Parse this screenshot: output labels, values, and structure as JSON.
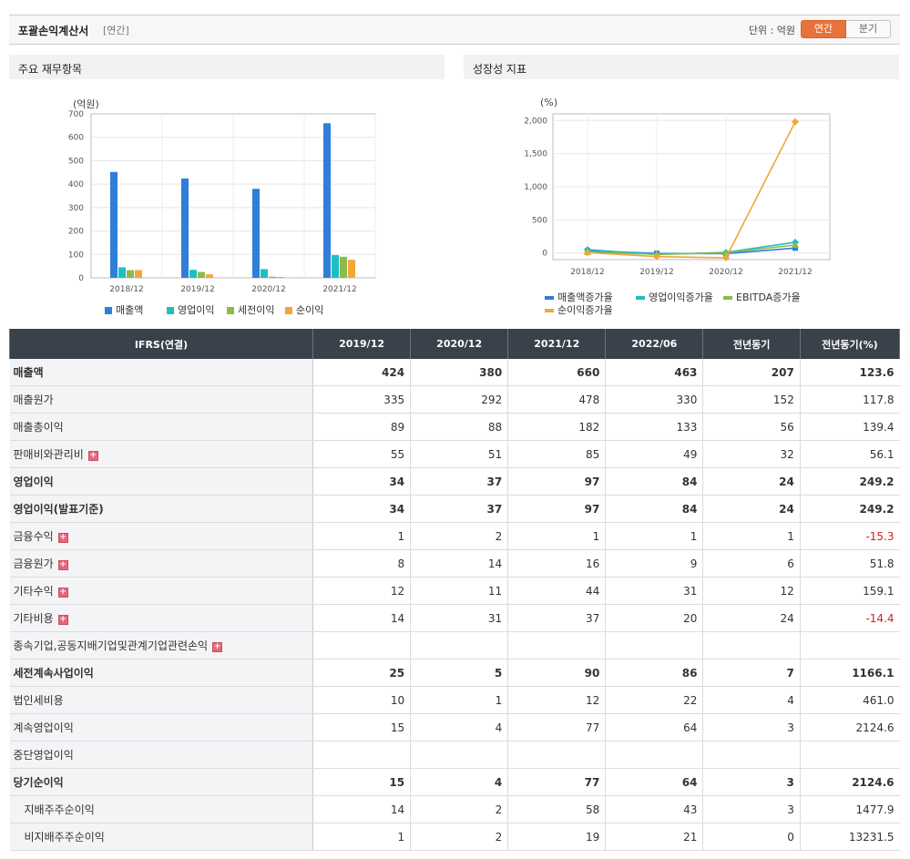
{
  "header": {
    "title": "포괄손익계산서",
    "subtitle": "[연간]",
    "unit": "단위 : 억원",
    "tab_annual": "연간",
    "tab_quarter": "분기"
  },
  "panels": {
    "left_title": "주요 재무항목",
    "right_title": "성장성 지표"
  },
  "colors": {
    "sales": "#2f7ed8",
    "operating": "#1fbfbf",
    "pretax": "#8bbc4a",
    "net": "#f3a53a",
    "header_bg": "#39414b",
    "accent": "#e8733a",
    "negative": "#d12020"
  },
  "chart_data": [
    {
      "type": "bar",
      "ylabel": "(억원)",
      "categories": [
        "2018/12",
        "2019/12",
        "2020/12",
        "2021/12"
      ],
      "ylim": [
        0,
        700
      ],
      "yticks": [
        "0",
        "100",
        "200",
        "300",
        "400",
        "500",
        "600",
        "700"
      ],
      "series": [
        {
          "name": "매출액",
          "values": [
            452,
            424,
            380,
            660
          ]
        },
        {
          "name": "영업이익",
          "values": [
            45,
            34,
            37,
            97
          ]
        },
        {
          "name": "세전이익",
          "values": [
            33,
            25,
            5,
            90
          ]
        },
        {
          "name": "순이익",
          "values": [
            33,
            15,
            4,
            77
          ]
        }
      ],
      "legend": "bottom"
    },
    {
      "type": "line",
      "ylabel": "(%)",
      "categories": [
        "2018/12",
        "2019/12",
        "2020/12",
        "2021/12"
      ],
      "ylim": [
        -100,
        2100
      ],
      "yticks": [
        "0",
        "500",
        "1,000",
        "1,500",
        "2,000"
      ],
      "series": [
        {
          "name": "매출액증가율",
          "values": [
            35,
            -6,
            -10,
            74
          ]
        },
        {
          "name": "영업이익증가율",
          "values": [
            50,
            -24,
            9,
            162
          ]
        },
        {
          "name": "EBITDA증가율",
          "values": [
            10,
            -20,
            5,
            120
          ]
        },
        {
          "name": "순이익증가율",
          "values": [
            5,
            -55,
            -73,
            1980
          ]
        }
      ],
      "legend": "bottom"
    }
  ],
  "table": {
    "headers": [
      "IFRS(연결)",
      "2019/12",
      "2020/12",
      "2021/12",
      "2022/06",
      "전년동기",
      "전년동기(%)"
    ],
    "rows": [
      {
        "label": "매출액",
        "values": [
          "424",
          "380",
          "660",
          "463",
          "207",
          "123.6"
        ],
        "bold": true
      },
      {
        "label": "매출원가",
        "values": [
          "335",
          "292",
          "478",
          "330",
          "152",
          "117.8"
        ]
      },
      {
        "label": "매출총이익",
        "values": [
          "89",
          "88",
          "182",
          "133",
          "56",
          "139.4"
        ]
      },
      {
        "label": "판매비와관리비",
        "values": [
          "55",
          "51",
          "85",
          "49",
          "32",
          "56.1"
        ],
        "expand": true
      },
      {
        "label": "영업이익",
        "values": [
          "34",
          "37",
          "97",
          "84",
          "24",
          "249.2"
        ],
        "bold": true
      },
      {
        "label": "영업이익(발표기준)",
        "values": [
          "34",
          "37",
          "97",
          "84",
          "24",
          "249.2"
        ],
        "bold": true
      },
      {
        "label": "금융수익",
        "values": [
          "1",
          "2",
          "1",
          "1",
          "1",
          "-15.3"
        ],
        "expand": true
      },
      {
        "label": "금융원가",
        "values": [
          "8",
          "14",
          "16",
          "9",
          "6",
          "51.8"
        ],
        "expand": true
      },
      {
        "label": "기타수익",
        "values": [
          "12",
          "11",
          "44",
          "31",
          "12",
          "159.1"
        ],
        "expand": true
      },
      {
        "label": "기타비용",
        "values": [
          "14",
          "31",
          "37",
          "20",
          "24",
          "-14.4"
        ],
        "expand": true
      },
      {
        "label": "종속기업,공동지배기업및관계기업관련손익",
        "values": [
          "",
          "",
          "",
          "",
          "",
          ""
        ],
        "expand": true
      },
      {
        "label": "세전계속사업이익",
        "values": [
          "25",
          "5",
          "90",
          "86",
          "7",
          "1166.1"
        ],
        "bold": true
      },
      {
        "label": "법인세비용",
        "values": [
          "10",
          "1",
          "12",
          "22",
          "4",
          "461.0"
        ]
      },
      {
        "label": "계속영업이익",
        "values": [
          "15",
          "4",
          "77",
          "64",
          "3",
          "2124.6"
        ]
      },
      {
        "label": "중단영업이익",
        "values": [
          "",
          "",
          "",
          "",
          "",
          ""
        ]
      },
      {
        "label": "당기순이익",
        "values": [
          "15",
          "4",
          "77",
          "64",
          "3",
          "2124.6"
        ],
        "bold": true
      },
      {
        "label": "지배주주순이익",
        "values": [
          "14",
          "2",
          "58",
          "43",
          "3",
          "1477.9"
        ],
        "indent": true
      },
      {
        "label": "비지배주주순이익",
        "values": [
          "1",
          "2",
          "19",
          "21",
          "0",
          "13231.5"
        ],
        "indent": true
      }
    ]
  }
}
